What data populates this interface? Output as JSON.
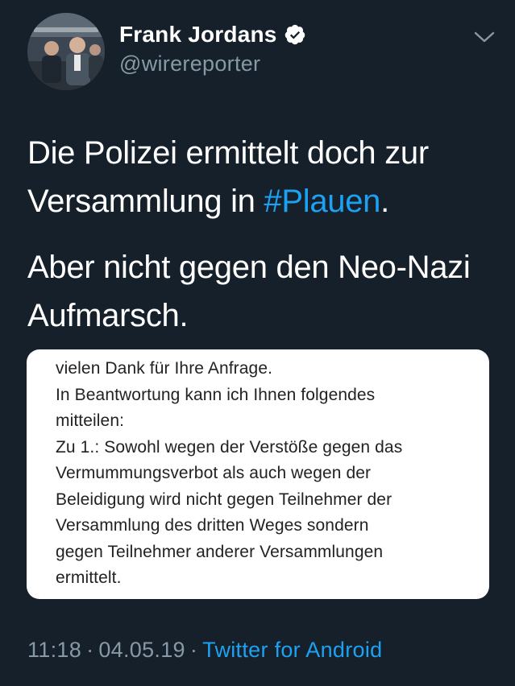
{
  "author": {
    "display_name": "Frank Jordans",
    "handle": "@wirereporter",
    "verified": true
  },
  "icons": {
    "verified": "verified-badge-icon",
    "menu": "chevron-down-icon"
  },
  "tweet": {
    "line1_prefix": "Die Polizei ermittelt doch zur Versammlung in ",
    "hashtag": "#Plauen",
    "line1_suffix": ".",
    "paragraph2": "Aber nicht gegen den Neo-Nazi Aufmarsch."
  },
  "attachment": {
    "lines": [
      "vielen Dank für Ihre Anfrage.",
      "In Beantwortung kann ich Ihnen folgendes",
      "mitteilen:",
      "Zu 1.: Sowohl wegen der Verstöße gegen das",
      "Vermummungsverbot als auch wegen der",
      "Beleidigung wird nicht gegen Teilnehmer der",
      "Versammlung des dritten Weges sondern",
      "gegen Teilnehmer anderer Versammlungen",
      "ermittelt."
    ]
  },
  "meta": {
    "time": "11:18",
    "separator": "·",
    "date": "04.05.19",
    "source": "Twitter for Android"
  },
  "colors": {
    "background": "#15202b",
    "secondary_text": "#8899a6",
    "link": "#1da1f2",
    "primary_text": "#ffffff"
  }
}
